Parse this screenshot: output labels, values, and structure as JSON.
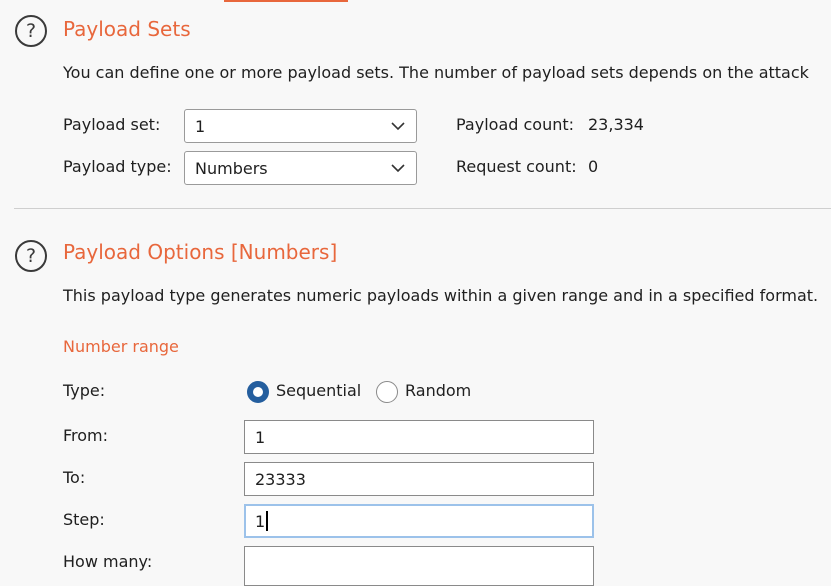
{
  "payload_sets": {
    "title": "Payload Sets",
    "description": "You can define one or more payload sets. The number of payload sets depends on the attack",
    "payload_set_label": "Payload set:",
    "payload_set_value": "1",
    "payload_type_label": "Payload type:",
    "payload_type_value": "Numbers",
    "payload_count_label": "Payload count:",
    "payload_count_value": "23,334",
    "request_count_label": "Request count:",
    "request_count_value": "0"
  },
  "payload_options": {
    "title": "Payload Options [Numbers]",
    "description": "This payload type generates numeric payloads within a given range and in a specified format.",
    "number_range": {
      "subtitle": "Number range",
      "type_label": "Type:",
      "sequential_label": "Sequential",
      "random_label": "Random",
      "selected_type": "Sequential",
      "from_label": "From:",
      "from_value": "1",
      "to_label": "To:",
      "to_value": "23333",
      "step_label": "Step:",
      "step_value": "1",
      "how_many_label": "How many:",
      "how_many_value": ""
    }
  },
  "icons": {
    "help": "?"
  },
  "colors": {
    "accent": "#e8673c",
    "radio_selected": "#245e9e",
    "focus": "#9cc2ea"
  }
}
